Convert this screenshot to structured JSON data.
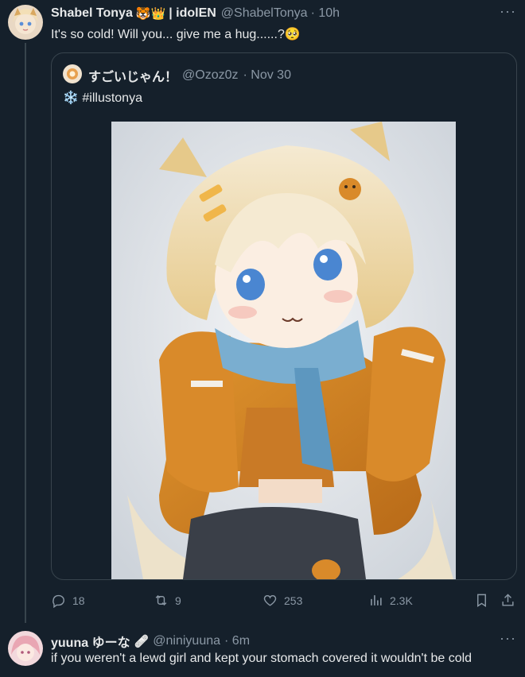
{
  "tweet": {
    "author_name": "Shabel Tonya",
    "author_emoji": "🐯👑",
    "author_suffix": "| idolEN",
    "handle": "@ShabelTonya",
    "time": "· 10h",
    "text": "It's so cold! Will you... give me a hug......?",
    "text_emoji": "🥺",
    "more_label": "···"
  },
  "quoted": {
    "author_name": "すごいじゃん！",
    "handle": "@Ozoz0z",
    "time": "· Nov 30",
    "text_emoji": "❄️",
    "text": "#illustonya"
  },
  "actions": {
    "replies": "18",
    "retweets": "9",
    "likes": "253",
    "views": "2.3K"
  },
  "reply": {
    "author_name": "yuuna ゆーな",
    "author_emoji": "🩹",
    "handle": "@niniyuuna",
    "time": "· 6m",
    "text": "if you weren't a lewd girl and kept your stomach covered it wouldn't be cold",
    "more_label": "···"
  },
  "colors": {
    "background": "#15202b",
    "muted": "#8b98a5",
    "border": "#38444d"
  }
}
